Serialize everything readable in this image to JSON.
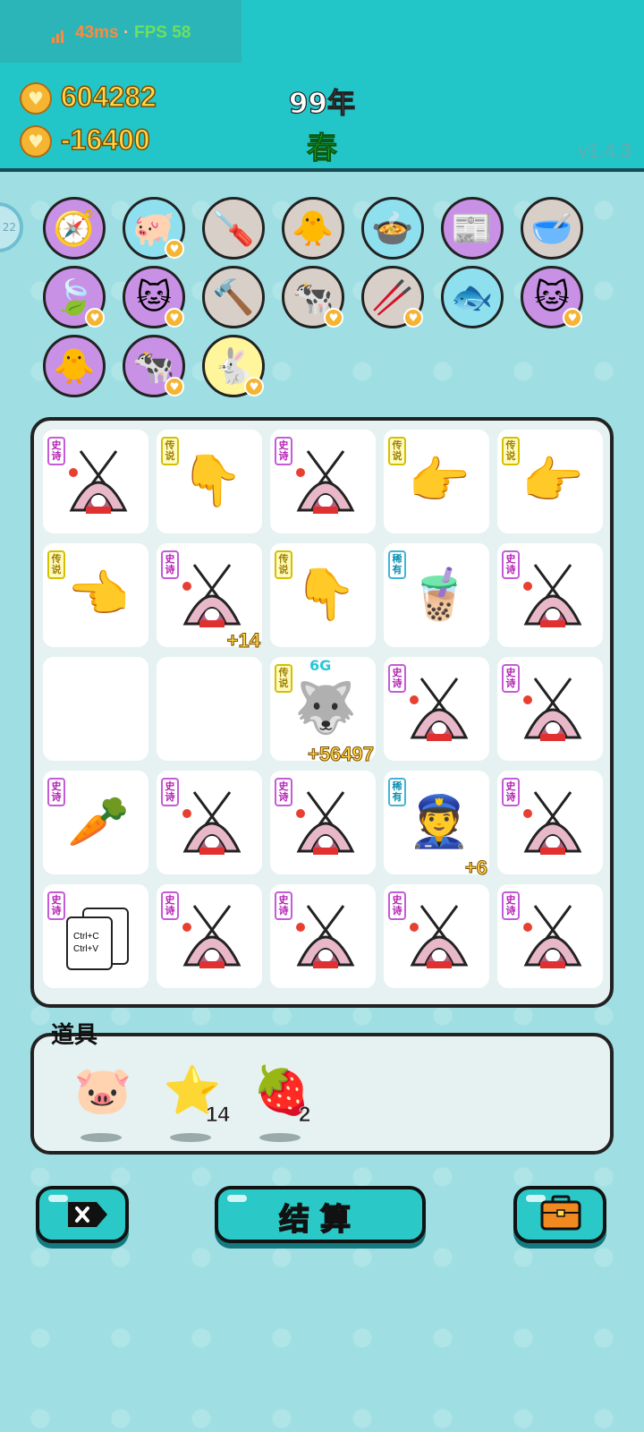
{
  "status": {
    "ping": "43ms",
    "separator": "·",
    "fps": "FPS 58"
  },
  "header": {
    "money": "604282",
    "income": "-16400",
    "year": "99年",
    "season": "春",
    "version": "v1.4.3"
  },
  "side_button": {
    "label": "22"
  },
  "items": [
    {
      "name": "compass-icon",
      "color": "purple"
    },
    {
      "name": "piggy-bank-icon",
      "color": "blue",
      "has_coin": true
    },
    {
      "name": "screwdriver-icon",
      "color": "beige"
    },
    {
      "name": "chick-egg-icon",
      "color": "beige"
    },
    {
      "name": "pressure-cooker-duck-icon",
      "color": "blue"
    },
    {
      "name": "time-magazine-icon",
      "color": "purple"
    },
    {
      "name": "pet-bowl-icon",
      "color": "beige"
    },
    {
      "name": "leaf-icon",
      "color": "purple",
      "has_coin": true
    },
    {
      "name": "cats-icon",
      "color": "purple",
      "has_coin": true
    },
    {
      "name": "hammer-icon",
      "color": "beige"
    },
    {
      "name": "cows-icon",
      "color": "beige",
      "has_coin": true
    },
    {
      "name": "chopsticks-icon",
      "color": "beige",
      "has_coin": true
    },
    {
      "name": "fishbowl-icon",
      "color": "blue"
    },
    {
      "name": "cats-icon",
      "color": "purple",
      "has_coin": true
    },
    {
      "name": "chick-egg-icon",
      "color": "purple"
    },
    {
      "name": "cows-icon",
      "color": "purple",
      "has_coin": true
    },
    {
      "name": "white-rabbit-icon",
      "color": "yellow",
      "has_coin": true
    }
  ],
  "tags": {
    "epic": "史诗",
    "legend": "传说",
    "rare": "稀有"
  },
  "board": [
    [
      {
        "type": "epic",
        "icon": "rabbit-tent-icon"
      },
      {
        "type": "legend",
        "icon": "pointing-hand-down-icon"
      },
      {
        "type": "epic",
        "icon": "rabbit-tent-icon"
      },
      {
        "type": "legend",
        "icon": "pointing-hand-diag-icon"
      },
      {
        "type": "legend",
        "icon": "pointing-hand-right-icon"
      }
    ],
    [
      {
        "type": "legend",
        "icon": "pointing-hand-left-icon"
      },
      {
        "type": "epic",
        "icon": "rabbit-tent-icon",
        "bonus": "+14"
      },
      {
        "type": "legend",
        "icon": "pointing-hand-down-icon"
      },
      {
        "type": "rare",
        "icon": "bubble-tea-icon"
      },
      {
        "type": "epic",
        "icon": "rabbit-tent-icon"
      }
    ],
    [
      {
        "type": "empty"
      },
      {
        "type": "empty"
      },
      {
        "type": "legend",
        "icon": "husky-king-icon",
        "bonus": "+56497",
        "top": "6G"
      },
      {
        "type": "epic",
        "icon": "rabbit-tent-icon"
      },
      {
        "type": "epic",
        "icon": "rabbit-tent-icon"
      }
    ],
    [
      {
        "type": "epic",
        "icon": "carrot-icon"
      },
      {
        "type": "epic",
        "icon": "rabbit-tent-icon"
      },
      {
        "type": "epic",
        "icon": "rabbit-tent-icon"
      },
      {
        "type": "rare",
        "icon": "police-face-icon",
        "bonus": "+6"
      },
      {
        "type": "epic",
        "icon": "rabbit-tent-icon"
      }
    ],
    [
      {
        "type": "epic",
        "icon": "ctrl-c-v-icon"
      },
      {
        "type": "epic",
        "icon": "rabbit-tent-icon"
      },
      {
        "type": "epic",
        "icon": "rabbit-tent-icon"
      },
      {
        "type": "epic",
        "icon": "rabbit-tent-icon"
      },
      {
        "type": "epic",
        "icon": "rabbit-tent-icon"
      }
    ]
  ],
  "ctrl_card": {
    "line1": "Ctrl+C",
    "line2": "Ctrl+V"
  },
  "props": {
    "label": "道具",
    "items": [
      {
        "name": "pink-piggy-bank-icon",
        "count": ""
      },
      {
        "name": "star-icon",
        "count": "14"
      },
      {
        "name": "bayberry-icon",
        "count": "2"
      }
    ]
  },
  "buttons": {
    "settle": "结算"
  },
  "colors": {
    "teal": "#22c6c8",
    "gold": "#ffd84a",
    "epic": "#b51fb5",
    "legend": "#d4c000",
    "rare": "#41b5d8"
  }
}
